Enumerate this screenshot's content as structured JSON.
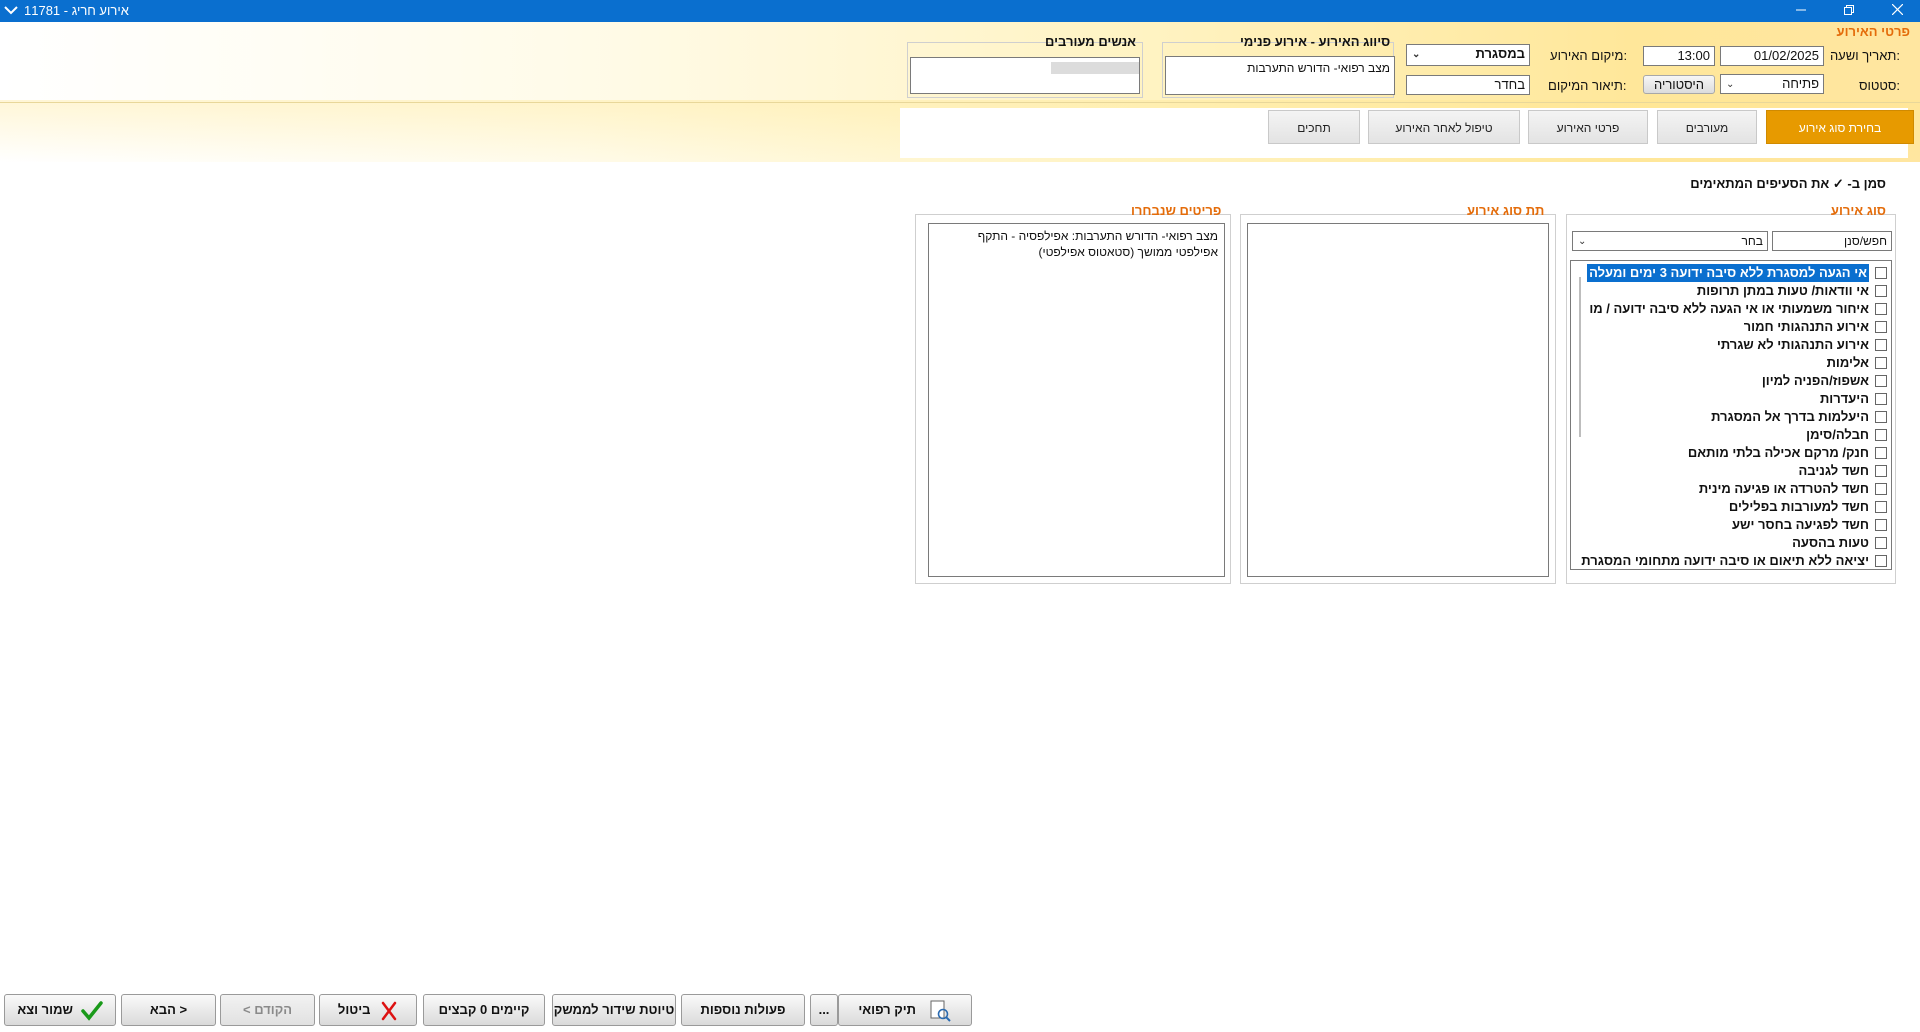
{
  "window": {
    "title": "אירוע חריג - 11781"
  },
  "header": {
    "section_title": "פרטי האירוע",
    "date_label": "תאריך ושעה:",
    "date_value": "01/02/2025",
    "time_value": "13:00",
    "location_label": "מיקום האירוע:",
    "location_value": "במסגרת",
    "status_label": "סטטוס:",
    "status_value": "פתיחה",
    "history_button": "היסטוריה",
    "location_desc_label": "תיאור המיקום:",
    "location_desc_value": "בחדר",
    "classification_title": "סיווג האירוע - אירוע פנימי",
    "classification_value": "מצב רפואי- הדורש התערבות",
    "people_title": "אנשים מעורבים"
  },
  "tabs": [
    {
      "label": "בחירת סוג אירוע",
      "active": true
    },
    {
      "label": "מעורבים",
      "active": false
    },
    {
      "label": "פרטי האירוע",
      "active": false
    },
    {
      "label": "טיפול לאחר האירוע",
      "active": false
    },
    {
      "label": "תחכים",
      "active": false
    }
  ],
  "instruction": "סמן ב- ✓ את הסעיפים המתאימים",
  "event_type": {
    "title": "סוג אירוע",
    "search_value": "חפש/סנן",
    "select_value": "בחר",
    "items": [
      "אי הגעה למסגרת ללא סיבה ידועה 3 ימים ומעלה",
      "אי וודאות/ טעות במתן תרופות",
      "איחור משמעותי או אי הגעה ללא סיבה ידועה / מו",
      "אירוע התנהגותי חמור",
      "אירוע התנהגותי לא שגרתי",
      "אלימות",
      "אשפוז/הפניה למיון",
      "היעדרות",
      "היעלמות בדרך אל המסגרת",
      "חבלה/סימן",
      "חנק/ מרקם אכילה בלתי מותאם",
      "חשד לגניבה",
      "חשד להטרדה או פגיעה מינית",
      "חשד למעורבות בפלילים",
      "חשד לפגיעה בחסר ישע",
      "טעות בהסעה",
      "יציאה ללא תיאום או סיבה ידועה מתחומי המסגרת"
    ]
  },
  "sub_type": {
    "title": "תת סוג אירוע"
  },
  "selected": {
    "title": "פריטים שנבחרו",
    "text": "מצב רפואי- הדורש התערבות: אפילפסיה - התקף אפילפטי ממושך (סטאטוס אפילפטי)"
  },
  "footer": {
    "save_exit": "שמור וצא",
    "next": "הבא >",
    "prev": "< הקודם",
    "cancel": "ביטול",
    "files": "קיימים 0 קבצים",
    "draft": "טיוטת שידור לממשק",
    "more_actions": "פעולות נוספות",
    "ellipsis": "...",
    "medical_file": "תיק רפואי"
  },
  "colors": {
    "titlebar": "#0a6fcf",
    "accent": "#e79a00",
    "section_title": "#e46c0a"
  }
}
